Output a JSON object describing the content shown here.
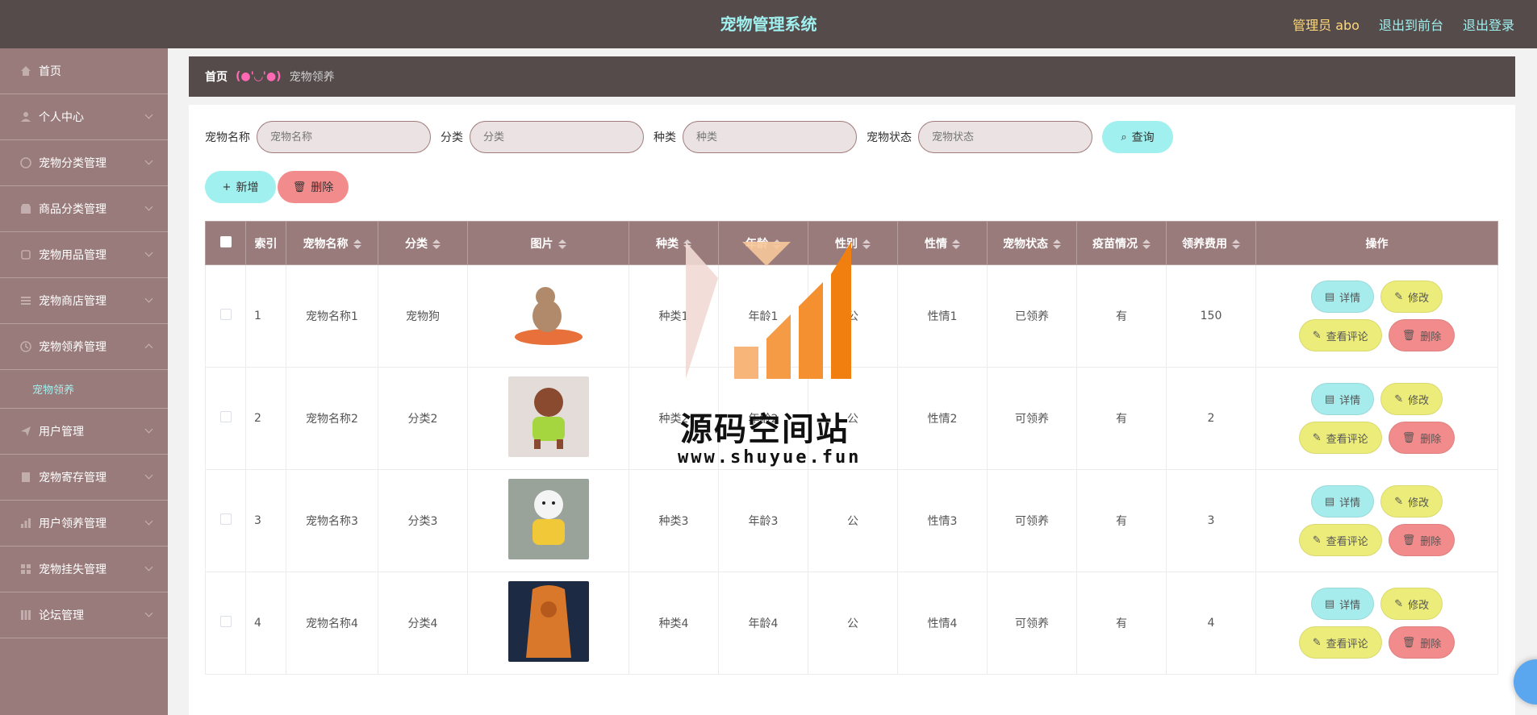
{
  "header": {
    "title": "宠物管理系统",
    "admin_label": "管理员 abo",
    "front_link": "退出到前台",
    "logout_link": "退出登录"
  },
  "sidebar": {
    "items": [
      {
        "label": "首页",
        "icon": "home-icon"
      },
      {
        "label": "个人中心",
        "icon": "user-icon"
      },
      {
        "label": "宠物分类管理",
        "icon": "globe-icon"
      },
      {
        "label": "商品分类管理",
        "icon": "shop-icon"
      },
      {
        "label": "宠物用品管理",
        "icon": "box-icon"
      },
      {
        "label": "宠物商店管理",
        "icon": "list-icon"
      },
      {
        "label": "宠物领养管理",
        "icon": "clock-icon"
      },
      {
        "label": "用户管理",
        "icon": "send-icon"
      },
      {
        "label": "宠物寄存管理",
        "icon": "building-icon"
      },
      {
        "label": "用户领养管理",
        "icon": "chart-icon"
      },
      {
        "label": "宠物挂失管理",
        "icon": "grid-icon"
      },
      {
        "label": "论坛管理",
        "icon": "books-icon"
      }
    ],
    "subitem": "宠物领养"
  },
  "breadcrumb": {
    "home": "首页",
    "sep": "(●'◡'●)",
    "current": "宠物领养"
  },
  "search": {
    "name_label": "宠物名称",
    "name_placeholder": "宠物名称",
    "category_label": "分类",
    "category_placeholder": "分类",
    "species_label": "种类",
    "species_placeholder": "种类",
    "status_label": "宠物状态",
    "status_placeholder": "宠物状态",
    "query_button": "查询"
  },
  "actions": {
    "add_button": "新增",
    "delete_button": "删除"
  },
  "table": {
    "columns": [
      "索引",
      "宠物名称",
      "分类",
      "图片",
      "种类",
      "年龄",
      "性别",
      "性情",
      "宠物状态",
      "疫苗情况",
      "领养费用",
      "操作"
    ],
    "rows": [
      {
        "index": "1",
        "name": "宠物名称1",
        "category": "宠物狗",
        "species": "种类1",
        "age": "年龄1",
        "gender": "公",
        "temper": "性情1",
        "status": "已领养",
        "vaccine": "有",
        "fee": "150"
      },
      {
        "index": "2",
        "name": "宠物名称2",
        "category": "分类2",
        "species": "种类2",
        "age": "年龄2",
        "gender": "公",
        "temper": "性情2",
        "status": "可领养",
        "vaccine": "有",
        "fee": "2"
      },
      {
        "index": "3",
        "name": "宠物名称3",
        "category": "分类3",
        "species": "种类3",
        "age": "年龄3",
        "gender": "公",
        "temper": "性情3",
        "status": "可领养",
        "vaccine": "有",
        "fee": "3"
      },
      {
        "index": "4",
        "name": "宠物名称4",
        "category": "分类4",
        "species": "种类4",
        "age": "年龄4",
        "gender": "公",
        "temper": "性情4",
        "status": "可领养",
        "vaccine": "有",
        "fee": "4"
      }
    ],
    "row_buttons": {
      "detail": "详情",
      "edit": "修改",
      "review": "查看评论",
      "remove": "删除"
    }
  },
  "watermark": {
    "text": "源码空间站",
    "url": "www.shuyue.fun"
  },
  "colors": {
    "topbar": "#554b4b",
    "sidebar": "#9a7b7b",
    "accent": "#9ff0ee",
    "danger": "#f28b8b",
    "warning": "#ecec7a"
  }
}
